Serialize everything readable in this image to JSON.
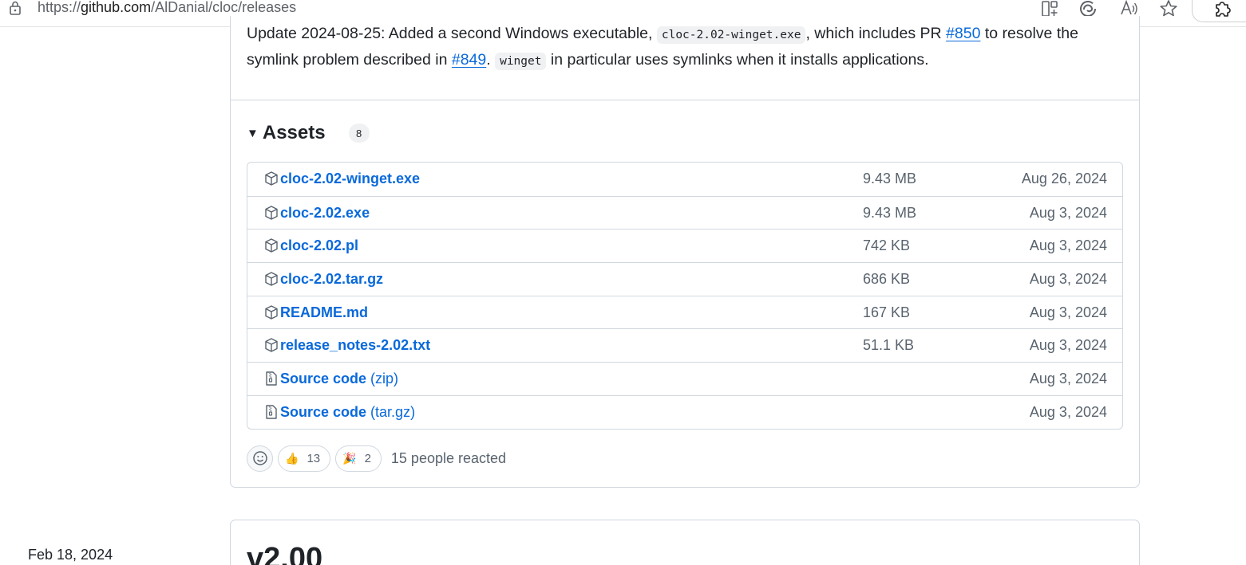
{
  "browser": {
    "url_prefix": "https://",
    "url_domain": "github.com",
    "url_path": "/AlDanial/cloc/releases",
    "icons": [
      "lock-icon",
      "split-screen-icon",
      "edge-copilot-icon",
      "read-aloud-icon",
      "favorite-star-icon",
      "extensions-icon"
    ]
  },
  "release": {
    "update_text_1": "Update 2024-08-25: Added a second Windows executable, ",
    "update_code_1": "cloc-2.02-winget.exe",
    "update_text_2": ", which includes PR ",
    "update_link_1": "#850",
    "update_text_3": " to resolve the symlink problem described in ",
    "update_link_2": "#849",
    "update_text_4": ". ",
    "update_code_2": "winget",
    "update_text_5": " in particular uses symlinks when it installs applications."
  },
  "assets": {
    "title": "Assets",
    "count": "8",
    "items": [
      {
        "name": "cloc-2.02-winget.exe",
        "suffix": "",
        "size": "9.43 MB",
        "date": "Aug 26, 2024",
        "icon": "package-icon"
      },
      {
        "name": "cloc-2.02.exe",
        "suffix": "",
        "size": "9.43 MB",
        "date": "Aug 3, 2024",
        "icon": "package-icon"
      },
      {
        "name": "cloc-2.02.pl",
        "suffix": "",
        "size": "742 KB",
        "date": "Aug 3, 2024",
        "icon": "package-icon"
      },
      {
        "name": "cloc-2.02.tar.gz",
        "suffix": "",
        "size": "686 KB",
        "date": "Aug 3, 2024",
        "icon": "package-icon"
      },
      {
        "name": "README.md",
        "suffix": "",
        "size": "167 KB",
        "date": "Aug 3, 2024",
        "icon": "package-icon"
      },
      {
        "name": "release_notes-2.02.txt",
        "suffix": "",
        "size": "51.1 KB",
        "date": "Aug 3, 2024",
        "icon": "package-icon"
      },
      {
        "name": "Source code",
        "suffix": " (zip)",
        "size": "",
        "date": "Aug 3, 2024",
        "icon": "file-zip-icon"
      },
      {
        "name": "Source code",
        "suffix": " (tar.gz)",
        "size": "",
        "date": "Aug 3, 2024",
        "icon": "file-zip-icon"
      }
    ]
  },
  "reactions": {
    "thumbs_up_emoji": "👍",
    "thumbs_up_count": "13",
    "tada_emoji": "🎉",
    "tada_count": "2",
    "summary": "15 people reacted"
  },
  "next_release": {
    "date": "Feb 18, 2024",
    "title": "v2.00"
  },
  "colors": {
    "link": "#0969da",
    "muted": "#59636e",
    "border": "#d0d7de",
    "text": "#1f2328"
  }
}
